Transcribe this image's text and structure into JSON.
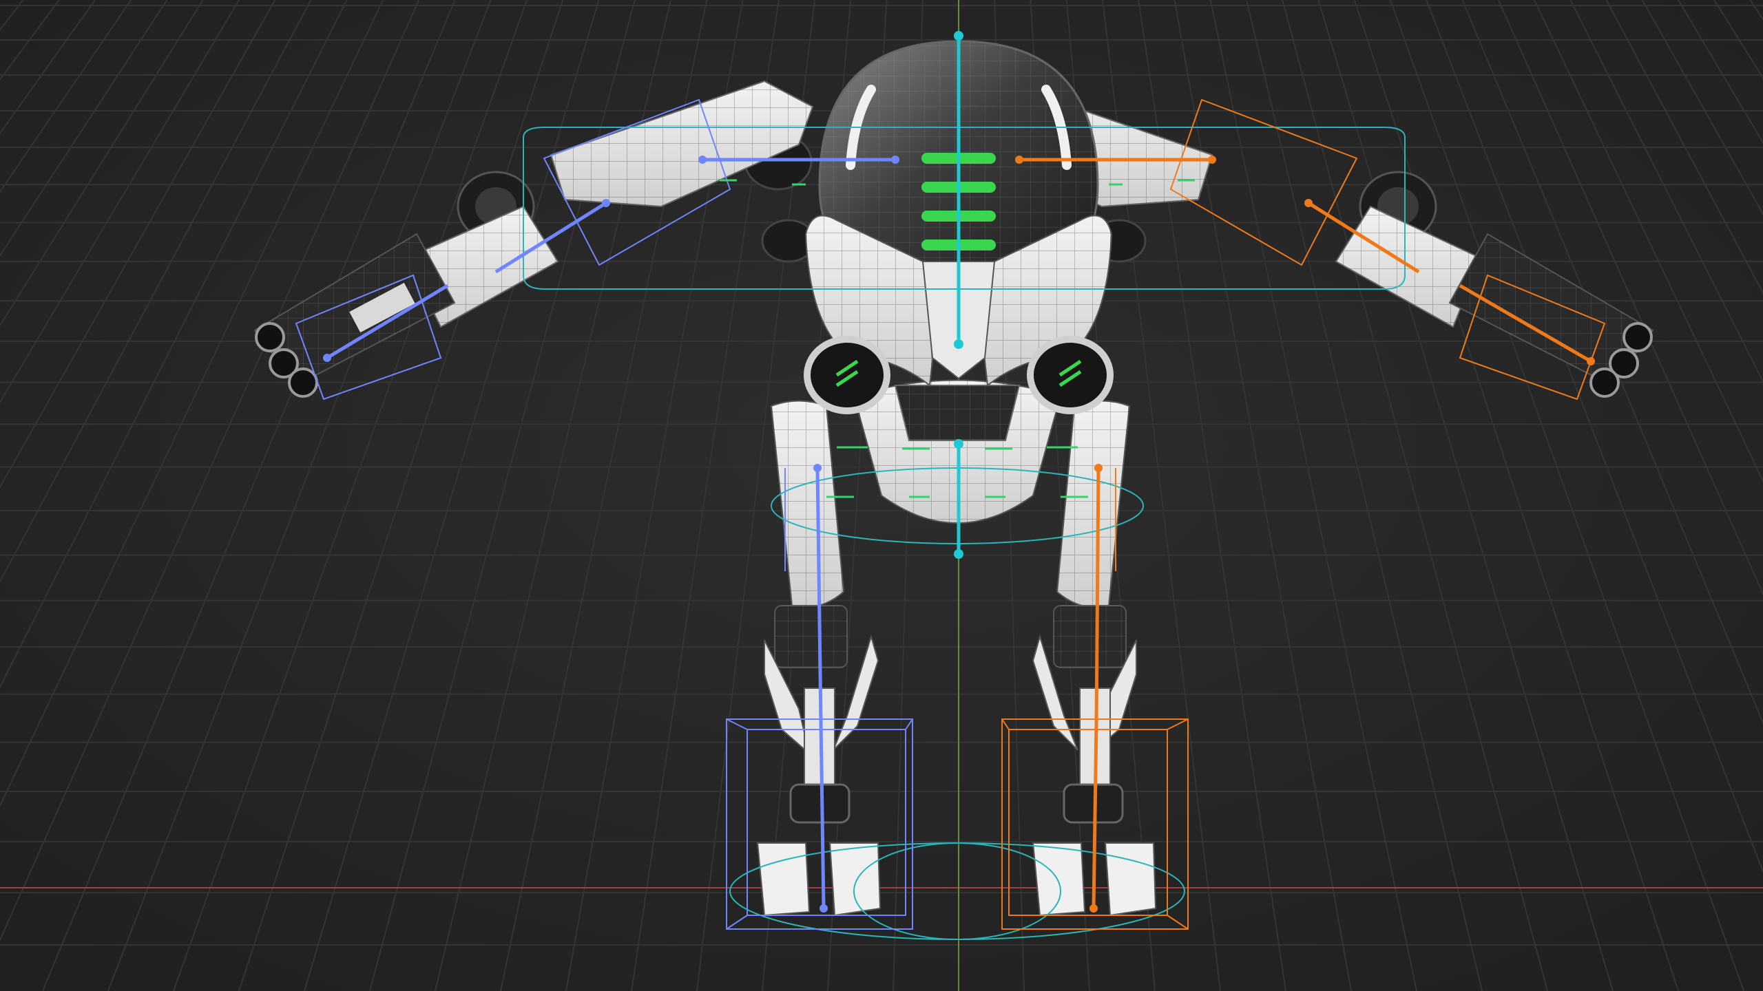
{
  "viewport": {
    "background_color": "#262626",
    "grid_color": "#343434",
    "x_axis_color": "#b03a3a",
    "z_axis_color": "#5f8f3a",
    "shading": "solid-with-wireframe-overlay"
  },
  "scene": {
    "subject": "robot-mech-rig",
    "pose": "T-pose",
    "rig_colors": {
      "left_side": "#6f86ff",
      "right_side": "#f07a1a",
      "center": "#1fc9d4",
      "helper": "#39d16a",
      "control_shapes": "#29b6b8"
    },
    "glow_color": "#3ad64f"
  }
}
